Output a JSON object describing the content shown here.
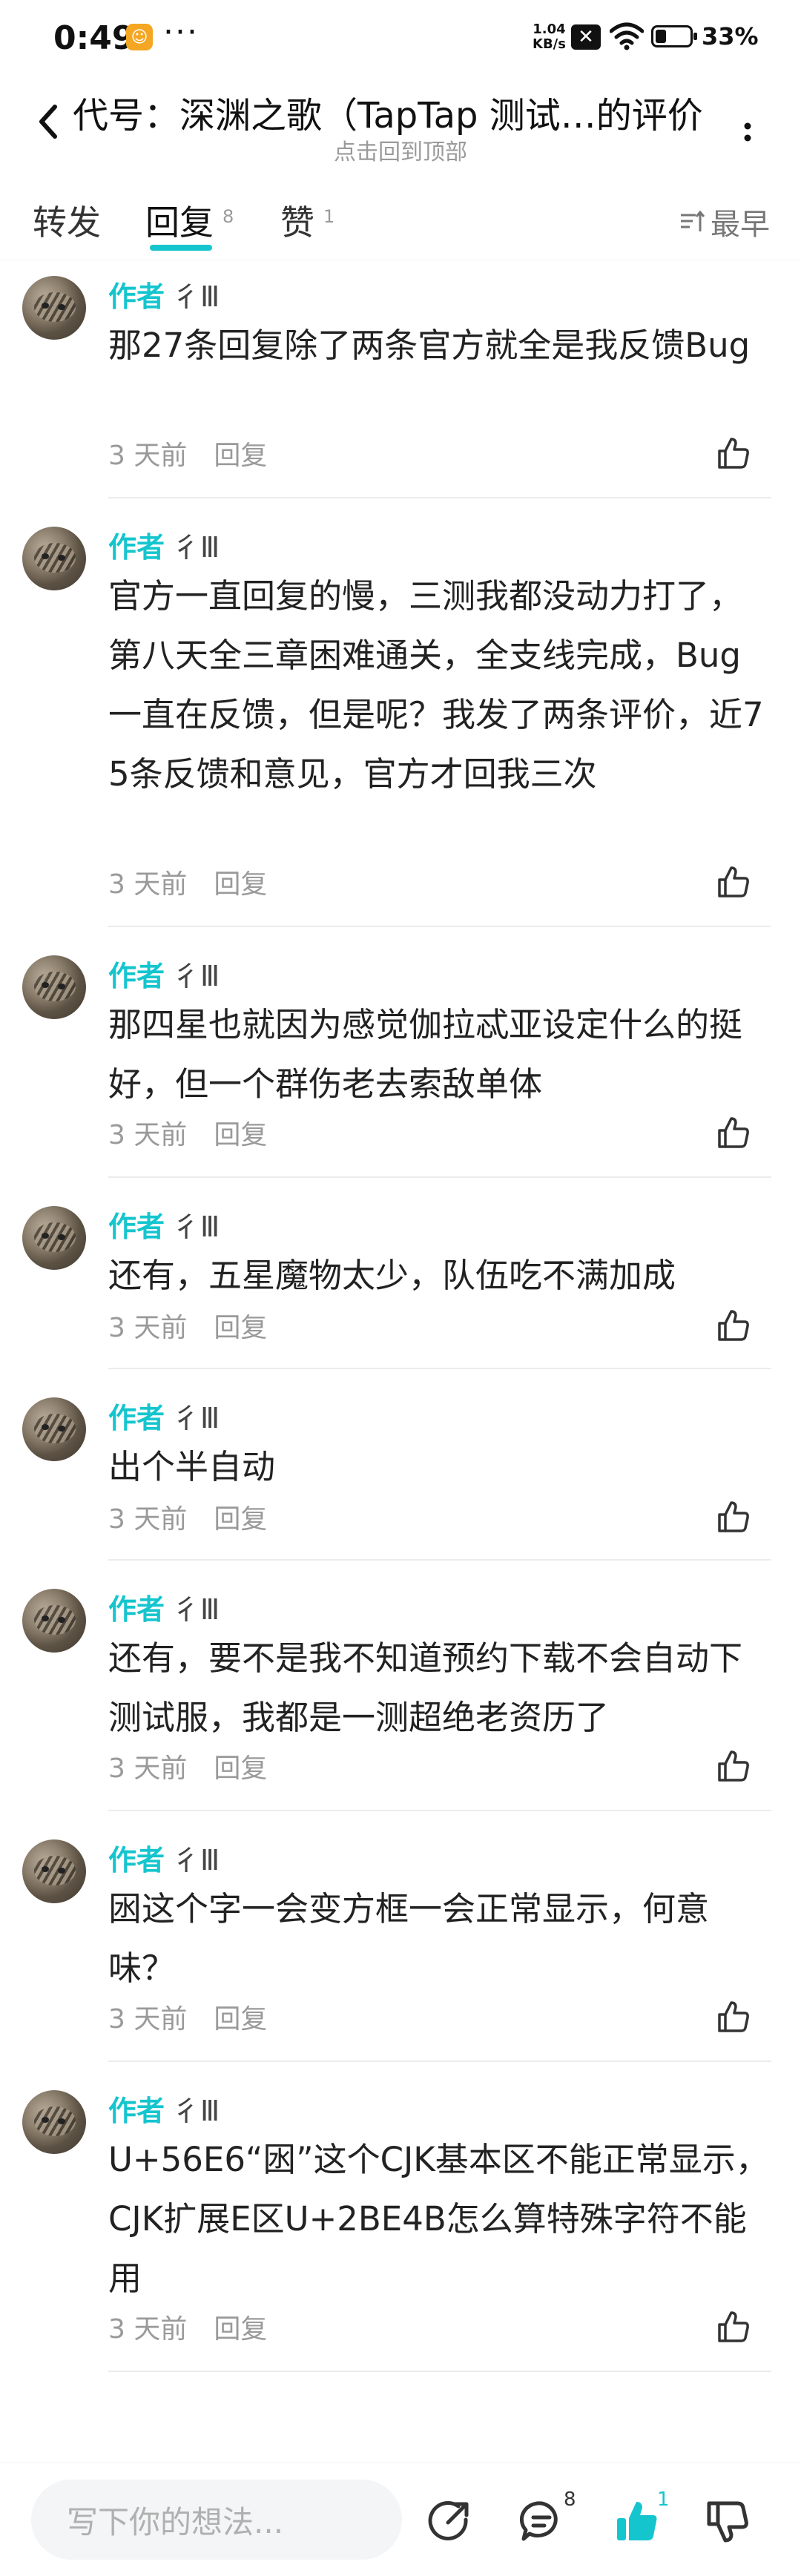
{
  "status_bar": {
    "time": "0:49",
    "more": "···",
    "net_speed_value": "1.04",
    "net_speed_unit": "KB/s",
    "battery": "33%"
  },
  "header": {
    "title": "代号：深渊之歌（TapTap 测试…的评价",
    "subtitle": "点击回到顶部"
  },
  "tabs": [
    {
      "label": "转发",
      "count": ""
    },
    {
      "label": "回复",
      "count": "8"
    },
    {
      "label": "赞",
      "count": "1"
    }
  ],
  "sort_label": "最早",
  "author_tag": "作者",
  "author_name": "彳Ⅲ",
  "reply_label": "回复",
  "comments": [
    {
      "text": "那27条回复除了两条官方就全是我反馈Bug",
      "time": "3 天前"
    },
    {
      "text": "官方一直回复的慢，三测我都没动力打了，第八天全三章困难通关，全支线完成，Bug一直在反馈，但是呢？我发了两条评价，近75条反馈和意见，官方才回我三次",
      "time": "3 天前"
    },
    {
      "text": "那四星也就因为感觉伽拉忒亚设定什么的挺好，但一个群伤老去索敌单体",
      "time": "3 天前"
    },
    {
      "text": "还有，五星魔物太少，队伍吃不满加成",
      "time": "3 天前"
    },
    {
      "text": "出个半自动",
      "time": "3 天前"
    },
    {
      "text": "还有，要不是我不知道预约下载不会自动下测试服，我都是一测超绝老资历了",
      "time": "3 天前"
    },
    {
      "text": "囦这个字一会变方框一会正常显示，何意味？",
      "time": "3 天前"
    },
    {
      "text": "U+56E6“囦”这个CJK基本区不能正常显示，CJK扩展E区U+2BE4B怎么算特殊字符不能用",
      "time": "3 天前"
    }
  ],
  "bottom_bar": {
    "input_placeholder": "写下你的想法...",
    "reply_count": "8",
    "like_count": "1"
  },
  "colors": {
    "accent": "#15c5ce",
    "muted": "#9a9a9a"
  }
}
